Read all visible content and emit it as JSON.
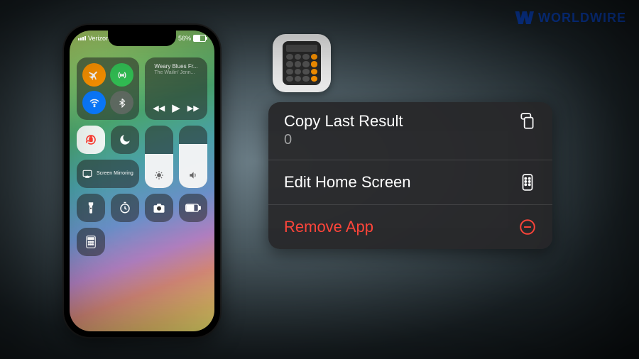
{
  "logo": {
    "mark": "W",
    "text": "WORLDWIRE"
  },
  "status": {
    "carrier": "Verizon",
    "battery_pct": "56%"
  },
  "control_center": {
    "media": {
      "title": "Weary Blues Fr...",
      "artist": "The Wailin' Jenn..."
    },
    "screen_mirroring": "Screen Mirroring",
    "brightness_pct": 55,
    "volume_pct": 70
  },
  "context_menu": {
    "app": "Calculator",
    "items": [
      {
        "label": "Copy Last Result",
        "result": "0",
        "icon": "copy"
      },
      {
        "label": "Edit Home Screen",
        "icon": "homescreen"
      },
      {
        "label": "Remove App",
        "icon": "remove",
        "danger": true
      }
    ]
  }
}
